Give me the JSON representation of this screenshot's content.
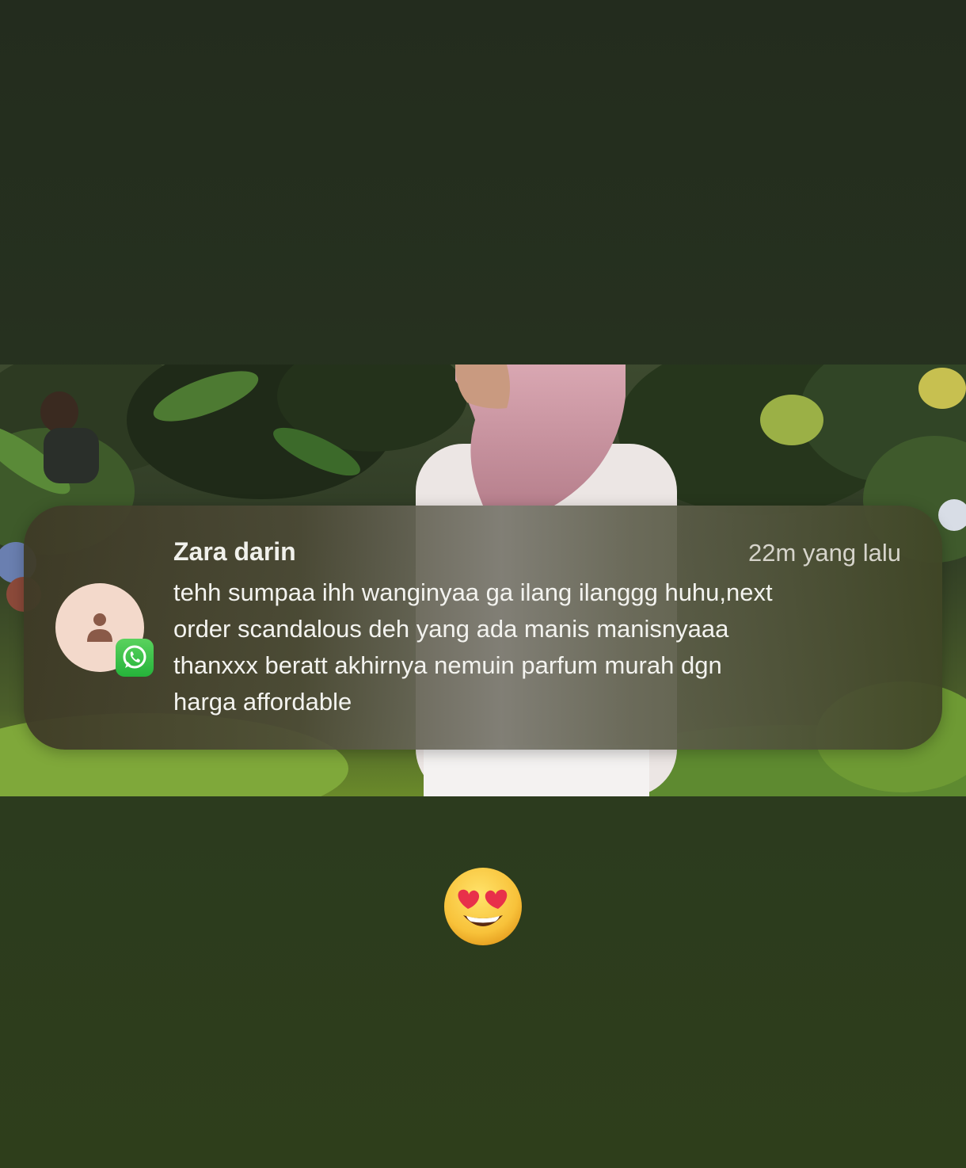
{
  "notification": {
    "sender_name": "Zara darin",
    "timestamp": "22m yang lalu",
    "message_lines": [
      "tehh sumpaa ihh wanginyaa ga ilang ilanggg huhu,next",
      "order scandalous deh yang ada manis manisnyaaa",
      "thanxxx beratt akhirnya nemuin parfum murah dgn",
      "harga affordable"
    ],
    "avatar_icon": "person-icon",
    "app_badge_icon": "whatsapp-icon"
  },
  "sticker": {
    "emoji": "heart-eyes-emoji"
  },
  "colors": {
    "background": "#26311f",
    "whatsapp_green": "#25b33a",
    "avatar_bg": "#f3d9cb",
    "avatar_person": "#8a5a48"
  }
}
